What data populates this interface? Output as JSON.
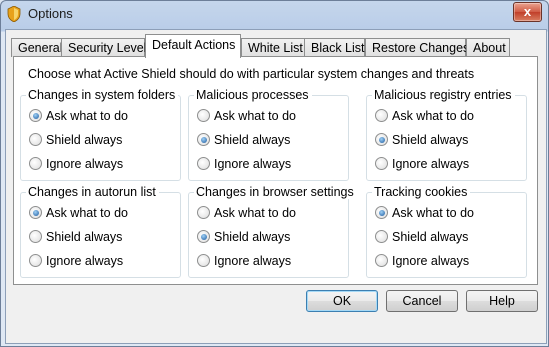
{
  "window": {
    "title": "Options",
    "close_symbol": "x"
  },
  "tabs": [
    {
      "label": "General"
    },
    {
      "label": "Security Level"
    },
    {
      "label": "Default Actions",
      "active": true
    },
    {
      "label": "White List"
    },
    {
      "label": "Black List"
    },
    {
      "label": "Restore Changes"
    },
    {
      "label": "About"
    }
  ],
  "panel": {
    "intro": "Choose what Active Shield should do with particular system changes and threats",
    "groups": [
      {
        "title": "Changes in system folders",
        "options": [
          "Ask what to do",
          "Shield always",
          "Ignore always"
        ],
        "selected": 0
      },
      {
        "title": "Malicious processes",
        "options": [
          "Ask what to do",
          "Shield always",
          "Ignore always"
        ],
        "selected": 1
      },
      {
        "title": "Malicious registry entries",
        "options": [
          "Ask what to do",
          "Shield always",
          "Ignore always"
        ],
        "selected": 1
      },
      {
        "title": "Changes in autorun list",
        "options": [
          "Ask what to do",
          "Shield always",
          "Ignore always"
        ],
        "selected": 0
      },
      {
        "title": "Changes in browser settings",
        "options": [
          "Ask what to do",
          "Shield always",
          "Ignore always"
        ],
        "selected": 1
      },
      {
        "title": "Tracking cookies",
        "options": [
          "Ask what to do",
          "Shield always",
          "Ignore always"
        ],
        "selected": 0
      }
    ]
  },
  "buttons": {
    "ok": "OK",
    "cancel": "Cancel",
    "help": "Help"
  }
}
